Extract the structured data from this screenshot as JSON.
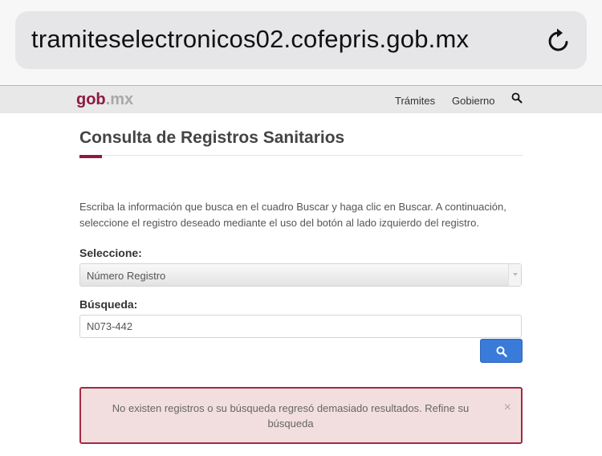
{
  "browser": {
    "url": "tramiteselectronicos02.cofepris.gob.mx",
    "reload_icon": "reload-icon"
  },
  "navbar": {
    "logo_gob": "gob",
    "logo_mx": ".mx",
    "links": [
      "Trámites",
      "Gobierno"
    ],
    "search_icon": "search-icon"
  },
  "page": {
    "title": "Consulta de Registros Sanitarios",
    "instructions": "Escriba la información que busca en el cuadro Buscar y haga clic en Buscar. A continuación, seleccione el registro deseado mediante el uso del botón al lado izquierdo del registro.",
    "select_label": "Seleccione:",
    "select_value": "Número Registro",
    "search_label": "Búsqueda:",
    "search_value": "N073-442",
    "search_button_icon": "search-icon"
  },
  "alert": {
    "message": "No existen registros o su búsqueda regresó demasiado resultados. Refine su búsqueda",
    "close": "×"
  },
  "colors": {
    "brand": "#8c1b3f",
    "button": "#3a7ad8",
    "alert_border": "#a52a45",
    "alert_bg": "#f2dede"
  }
}
